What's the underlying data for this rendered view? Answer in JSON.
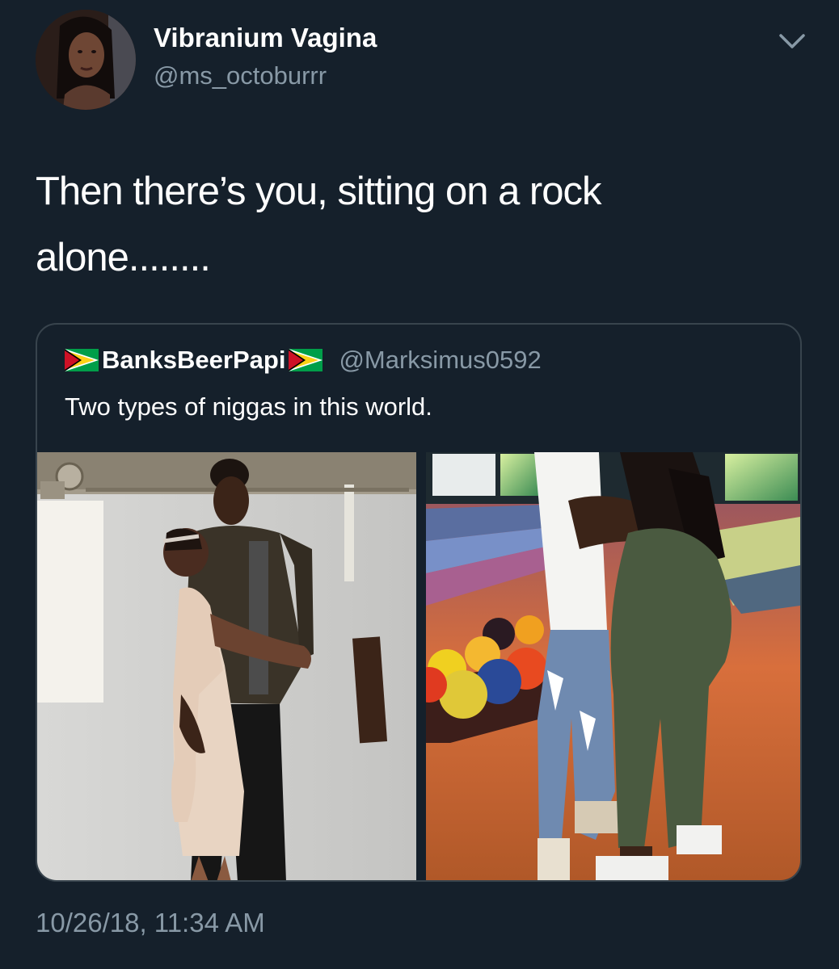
{
  "user": {
    "display_name": "Vibranium Vagina",
    "handle": "@ms_octoburrr",
    "avatar_icon": "user-avatar"
  },
  "tweet": {
    "text_line1": "Then there’s you, sitting on a rock",
    "text_line2": "alone........",
    "timestamp": "10/26/18, 11:34 AM"
  },
  "quoted_tweet": {
    "display_name": "BanksBeerPapi",
    "handle": "@Marksimus0592",
    "text": "Two types of niggas in this world.",
    "name_flag_icon": "guyana-flag-icon",
    "media": [
      {
        "icon": "photo-couple-hugging"
      },
      {
        "icon": "photo-couple-bowling-alley"
      }
    ]
  },
  "menu": {
    "icon": "chevron-down-icon"
  },
  "colors": {
    "background": "#15202b",
    "primary_text": "#ffffff",
    "secondary_text": "#8899a6",
    "border": "#38444d"
  }
}
